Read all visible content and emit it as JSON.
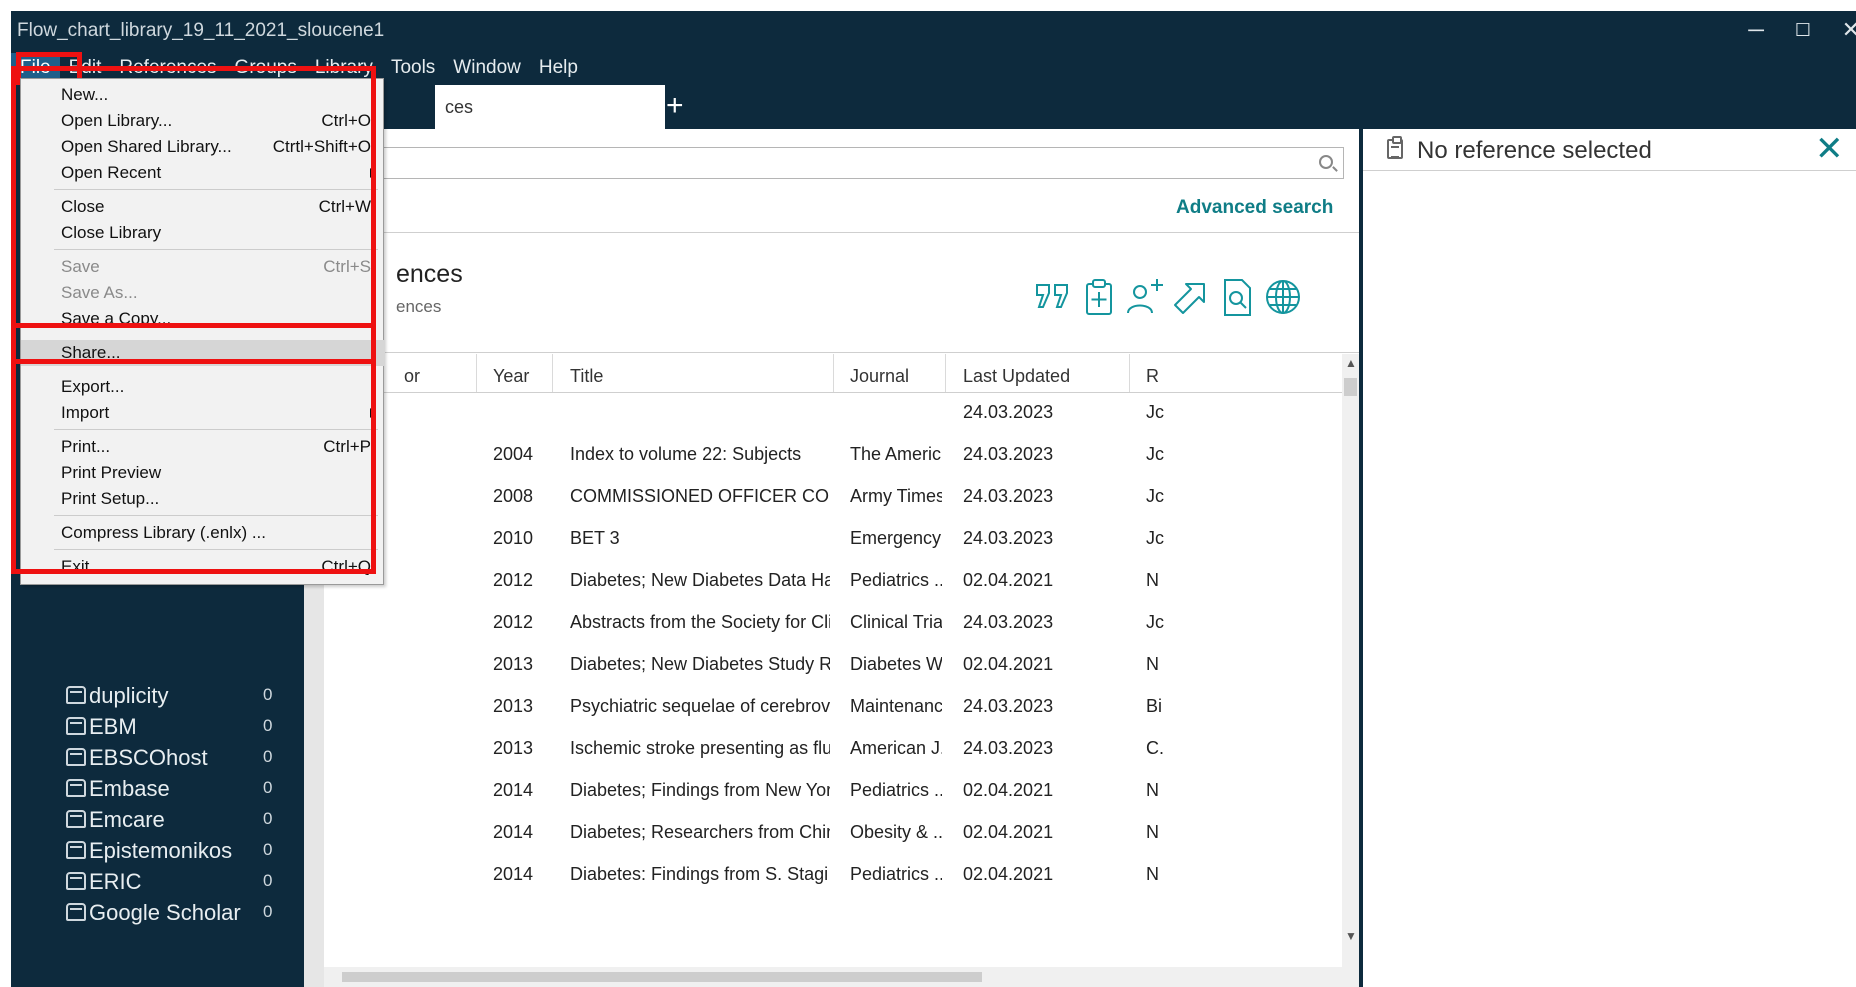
{
  "window": {
    "title": "Flow_chart_library_19_11_2021_sloucene1",
    "controls": {
      "minimize": "─",
      "maximize": "☐",
      "close": "✕"
    }
  },
  "menubar": [
    "File",
    "Edit",
    "References",
    "Groups",
    "Library",
    "Tools",
    "Window",
    "Help"
  ],
  "tab": {
    "label": "ces",
    "add": "+"
  },
  "search": {
    "placeholder": "",
    "advanced": "Advanced search"
  },
  "section": {
    "title": "ences",
    "subtitle": "ences"
  },
  "toolbar_icons": [
    "insert-citation-icon",
    "add-reference-icon",
    "share-user-icon",
    "export-icon",
    "find-fulltext-icon",
    "online-search-icon"
  ],
  "table": {
    "headers": [
      "or",
      "Year",
      "Title",
      "Journal",
      "Last Updated",
      "R"
    ],
    "rows": [
      [
        "",
        "",
        "",
        "",
        "24.03.2023",
        "Jc"
      ],
      [
        "",
        "2004",
        "Index to volume 22: Subjects",
        "The Americ...",
        "24.03.2023",
        "Jc"
      ],
      [
        "",
        "2008",
        "COMMISSIONED OFFICER CODES",
        "Army Times",
        "24.03.2023",
        "Jc"
      ],
      [
        "",
        "2010",
        "BET 3",
        "Emergency ...",
        "24.03.2023",
        "Jc"
      ],
      [
        "",
        "2012",
        "Diabetes; New Diabetes Data Have B...",
        "Pediatrics ...",
        "02.04.2021",
        "N"
      ],
      [
        "",
        "2012",
        "Abstracts from the Society for Clinic...",
        "Clinical Trials",
        "24.03.2023",
        "Jc"
      ],
      [
        "",
        "2013",
        "Diabetes; New Diabetes Study Resul...",
        "Diabetes W...",
        "02.04.2021",
        "N"
      ],
      [
        "",
        "2013",
        "Psychiatric sequelae of cerebrovasc...",
        "Maintenanc...",
        "24.03.2023",
        "Bi"
      ],
      [
        "",
        "2013",
        "Ischemic stroke presenting as fluctu...",
        "American J...",
        "24.03.2023",
        "C."
      ],
      [
        "",
        "2014",
        "Diabetes; Findings from New York U...",
        "Pediatrics ...",
        "02.04.2021",
        "N"
      ],
      [
        "",
        "2014",
        "Diabetes; Researchers from Chinese ...",
        "Obesity & ...",
        "02.04.2021",
        "N"
      ],
      [
        "",
        "2014",
        "Diabetes: Findings from S. Stagi and ...",
        "Pediatrics ...",
        "02.04.2021",
        "N"
      ]
    ]
  },
  "groups": [
    {
      "name": "duplicity",
      "count": "0"
    },
    {
      "name": "EBM",
      "count": "0"
    },
    {
      "name": "EBSCOhost",
      "count": "0"
    },
    {
      "name": "Embase",
      "count": "0"
    },
    {
      "name": "Emcare",
      "count": "0"
    },
    {
      "name": "Epistemonikos",
      "count": "0"
    },
    {
      "name": "ERIC",
      "count": "0"
    },
    {
      "name": "Google Scholar",
      "count": "0"
    }
  ],
  "right_panel": {
    "title": "No reference selected",
    "close": "✕"
  },
  "file_menu": {
    "items": [
      {
        "label": "New...",
        "shortcut": ""
      },
      {
        "label": "Open Library...",
        "shortcut": "Ctrl+O"
      },
      {
        "label": "Open Shared Library...",
        "shortcut": "Ctrtl+Shift+O"
      },
      {
        "label": "Open Recent",
        "shortcut": ""
      },
      {
        "label": "Close",
        "shortcut": "Ctrl+W"
      },
      {
        "label": "Close Library",
        "shortcut": ""
      },
      {
        "label": "Save",
        "shortcut": "Ctrl+S"
      },
      {
        "label": "Save As...",
        "shortcut": ""
      },
      {
        "label": "Save a Copy...",
        "shortcut": ""
      },
      {
        "label": "Share...",
        "shortcut": ""
      },
      {
        "label": "Export...",
        "shortcut": ""
      },
      {
        "label": "Import",
        "shortcut": ""
      },
      {
        "label": "Print...",
        "shortcut": "Ctrl+P"
      },
      {
        "label": "Print Preview",
        "shortcut": ""
      },
      {
        "label": "Print Setup...",
        "shortcut": ""
      },
      {
        "label": "Compress Library (.enlx) ...",
        "shortcut": ""
      },
      {
        "label": "Exit",
        "shortcut": "Ctrl+Q"
      }
    ]
  },
  "colors": {
    "chrome": "#0d2a3d",
    "accent": "#0f7d86",
    "highlight_box": "#ee1111"
  }
}
